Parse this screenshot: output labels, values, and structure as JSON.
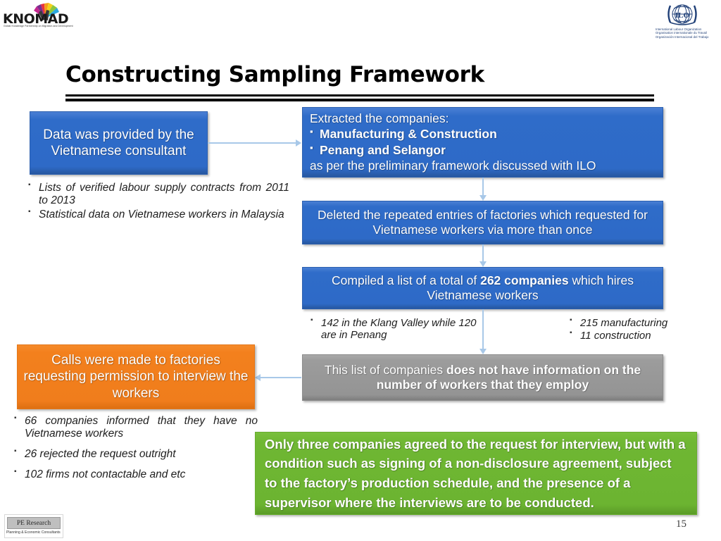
{
  "logos": {
    "knomad": {
      "wordmark": "KNOMAD",
      "tagline": "Global Knowledge Partnership on Migration and Development"
    },
    "ilo": {
      "emblem_text": "ILO",
      "lines": [
        "International Labour Organization",
        "Organisation internationale du Travail",
        "Organización Internacional del Trabajo"
      ]
    },
    "pe_research": {
      "name": "PE Research",
      "tagline": "Planning & Economic Consultants"
    }
  },
  "slide": {
    "title": "Constructing Sampling Framework",
    "page_number": "15"
  },
  "boxes": {
    "data_provided": {
      "text": "Data was provided by the Vietnamese consultant",
      "color": "#2f6cc9"
    },
    "extracted": {
      "header": "Extracted the companies:",
      "bullets": [
        "Manufacturing & Construction",
        "Penang and Selangor"
      ],
      "footer": "as per the preliminary framework discussed with ILO",
      "color": "#2f6cc9"
    },
    "deleted": {
      "text": "Deleted the repeated entries of factories which requested for Vietnamese workers via more than once",
      "color": "#2f6cc9"
    },
    "compiled": {
      "prefix": "Compiled a list of a total of ",
      "highlight": "262 companies",
      "suffix": " which hires Vietnamese workers",
      "color": "#2f6cc9"
    },
    "no_worker_info": {
      "prefix": "This list of companies ",
      "highlight": "does not have information on the number of workers that they employ",
      "color": "#949494"
    },
    "calls_made": {
      "text": "Calls were made to factories requesting permission to interview the workers",
      "color": "#f07d1c"
    },
    "outcome": {
      "text": "Only three companies agreed to the request for interview, but with a condition such as signing of a non-disclosure agreement, subject to the factory’s production schedule, and the presence of a supervisor where the interviews are to be conducted.",
      "color": "#6cb431"
    }
  },
  "bullet_lists": {
    "data_source_notes": [
      "Lists of verified labour supply contracts from 2011 to 2013",
      "Statistical data on Vietnamese workers in Malaysia"
    ],
    "location_breakdown": [
      "142 in the Klang Valley while 120 are in Penang"
    ],
    "sector_breakdown": [
      "215   manufacturing",
      "11 construction"
    ],
    "call_outcomes": [
      "66 companies informed that they have no Vietnamese workers",
      "26 rejected the request outright",
      "102 firms not contactable and etc"
    ]
  },
  "connectors": {
    "accent_color": "#a8c8e8"
  }
}
